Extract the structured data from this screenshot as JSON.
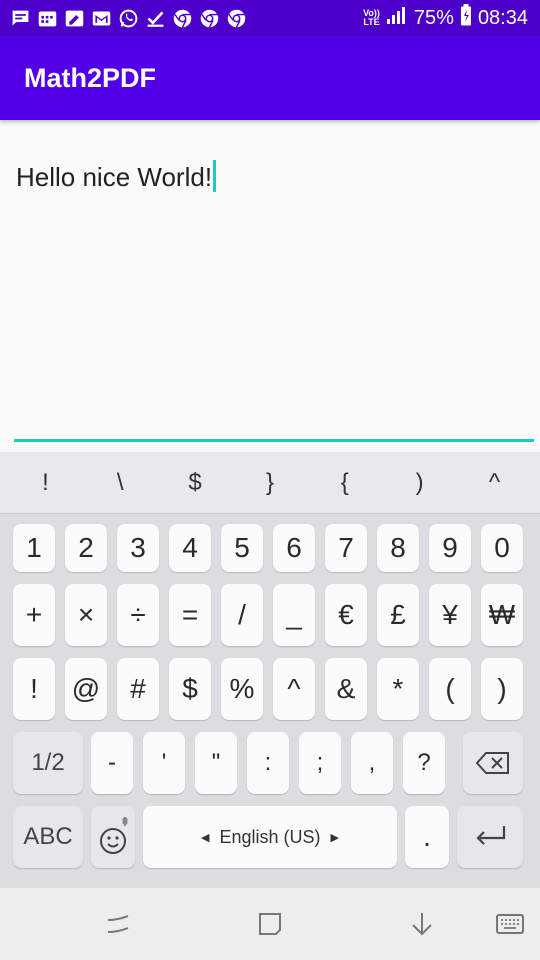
{
  "status_bar": {
    "notification_icons": [
      "message-icon",
      "calendar-icon",
      "note-icon",
      "gmail-icon",
      "whatsapp-icon",
      "checkmark-icon",
      "chrome-icon",
      "chrome-icon",
      "chrome-icon"
    ],
    "volte_line1": "Vo))",
    "volte_line2": "LTE",
    "battery_percent": "75%",
    "time": "08:34"
  },
  "app_bar": {
    "title": "Math2PDF"
  },
  "editor": {
    "text": "Hello nice World!"
  },
  "keyboard": {
    "suggestions": [
      "!",
      "\\",
      "$",
      "}",
      "{",
      ")",
      "^"
    ],
    "row1": [
      "1",
      "2",
      "3",
      "4",
      "5",
      "6",
      "7",
      "8",
      "9",
      "0"
    ],
    "row2": [
      "+",
      "×",
      "÷",
      "=",
      "/",
      "_",
      "€",
      "£",
      "¥",
      "₩"
    ],
    "row3": [
      "!",
      "@",
      "#",
      "$",
      "%",
      "^",
      "&",
      "*",
      "(",
      ")"
    ],
    "row4": {
      "page_key": "1/2",
      "keys": [
        "-",
        "'",
        "\"",
        ":",
        ";",
        ",",
        "?"
      ]
    },
    "row5": {
      "abc_key": "ABC",
      "space_label": "English (US)",
      "period_key": "."
    }
  },
  "colors": {
    "status_bar": "#4c00c9",
    "app_bar": "#5200e8",
    "accent": "#1fc8c8"
  }
}
